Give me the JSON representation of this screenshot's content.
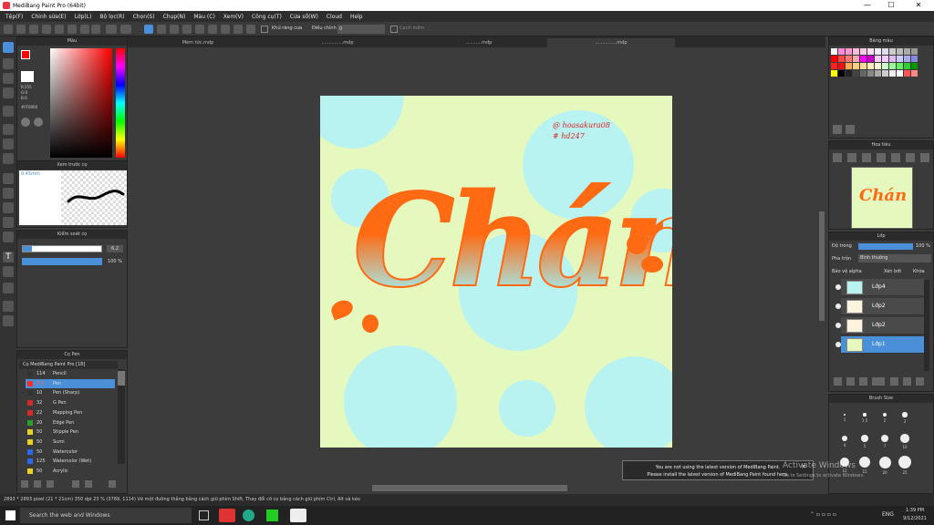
{
  "window": {
    "title": "MediBang Paint Pro (64bit)",
    "minimize": "—",
    "maximize": "☐",
    "close": "✕"
  },
  "menu": [
    "Tệp(F)",
    "Chỉnh sửa(E)",
    "Lớp(L)",
    "Bộ lọc(R)",
    "Chọn(S)",
    "Chụp(N)",
    "Màu (C)",
    "Xem(V)",
    "Công cụ(T)",
    "Cửa sổ(W)",
    "Cloud",
    "Help"
  ],
  "toolbar": {
    "antialias_label": "Khử răng cưa",
    "adjust_label": "Điều chỉnh",
    "adjust_value": "0",
    "edge_label": "Cạnh mềm"
  },
  "tabs": [
    "Mèm tức.mdp",
    "...............mdp",
    "...........mdp",
    "...............mdp"
  ],
  "color_panel": {
    "title": "Màu",
    "values": [
      "R:255",
      "G:0",
      "B:0"
    ],
    "hex": "#FF0000"
  },
  "preview_panel": {
    "title": "Xem trước cọ",
    "size": "0.45mm"
  },
  "brush_control": {
    "title": "Kiểm soát cọ",
    "size": "6.2",
    "opacity": "100 %"
  },
  "brush_list": {
    "title": "Cọ Pen",
    "group": "Cọ MediBang Paint Pro [18]",
    "items": [
      {
        "size": "114",
        "name": "Pencil",
        "color": "#333333"
      },
      {
        "size": "6.2",
        "name": "Pen",
        "color": "#ff2a2a",
        "selected": true
      },
      {
        "size": "10",
        "name": "Pen (Sharp)",
        "color": "#333333"
      },
      {
        "size": "32",
        "name": "G Pen",
        "color": "#d42a2a"
      },
      {
        "size": "22",
        "name": "Mapping Pen",
        "color": "#d42a2a"
      },
      {
        "size": "20",
        "name": "Edge Pen",
        "color": "#2aa02a"
      },
      {
        "size": "50",
        "name": "Stipple Pen",
        "color": "#e8d02a"
      },
      {
        "size": "50",
        "name": "Sumi",
        "color": "#e8d02a"
      },
      {
        "size": "50",
        "name": "Watercolor",
        "color": "#2a6ae8"
      },
      {
        "size": "125",
        "name": "Watercolor (Wet)",
        "color": "#2a6ae8"
      },
      {
        "size": "50",
        "name": "Acrylic",
        "color": "#e8d02a"
      }
    ]
  },
  "artwork": {
    "handle": "@ hoasakura08",
    "tag": "# hd247",
    "word": "Chán"
  },
  "palette_panel": {
    "title": "Bảng màu"
  },
  "navigator_panel": {
    "title": "Hoa tiêu"
  },
  "layer_panel": {
    "title": "Lớp",
    "opacity_label": "Độ trong",
    "opacity_value": "100 %",
    "blend_label": "Pha trộn",
    "blend_value": "Bình thường",
    "protect_alpha": "Bảo vệ alpha",
    "clipping": "Xén bớt",
    "lock": "Khóa",
    "layers": [
      "Lớp4",
      "Lớp2",
      "Lớp2",
      "Lớp1"
    ]
  },
  "brush_size_panel": {
    "title": "Brush Size",
    "sizes": [
      "1",
      "1.5",
      "2",
      "3",
      "4",
      "5",
      "7",
      "10",
      "12",
      "15",
      "20",
      "25"
    ]
  },
  "notification": {
    "line1": "You are not using the latest version of MediBang Paint.",
    "line2": "Please install the latest version of MediBang Paint found here."
  },
  "watermark": {
    "line1": "Activate Windows",
    "line2": "Go to Settings to activate Windows."
  },
  "statusbar": {
    "text": "2893 * 2893 pixel   (21 * 21cm)   350 dpi   23 %   (3789, 1114)   Vẽ một đường thẳng bằng cách giữ phím Shift, Thay đổi cỡ cọ bằng cách giữ phím Ctrl, Alt và kéo"
  },
  "taskbar": {
    "search": "Search the web and Windows",
    "lang": "ENG",
    "time": "1:39 PM",
    "date": "9/12/2021"
  },
  "colors": {
    "accent": "#4a90d9",
    "canvas_bg": "#e5f9bf",
    "circle": "#b8f3f2",
    "orange": "#ff6a13"
  }
}
